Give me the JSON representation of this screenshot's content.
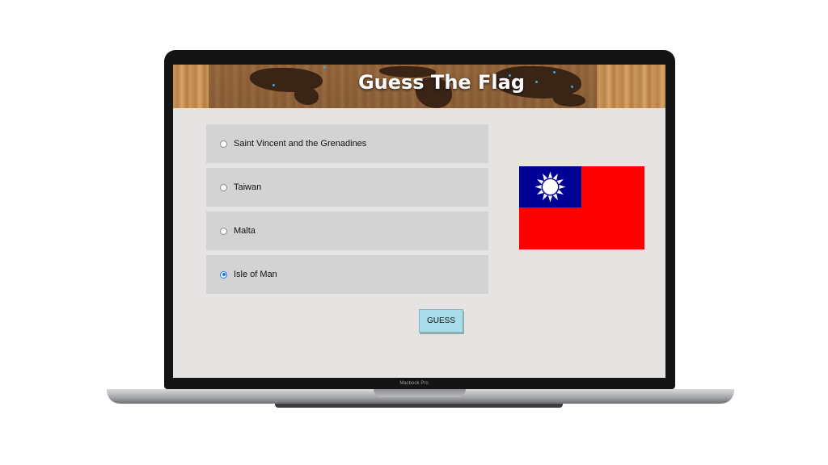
{
  "device": {
    "label": "Macbook Pro"
  },
  "app": {
    "title": "Guess The Flag"
  },
  "options": [
    {
      "label": "Saint Vincent and the Grenadines",
      "selected": false
    },
    {
      "label": "Taiwan",
      "selected": false
    },
    {
      "label": "Malta",
      "selected": false
    },
    {
      "label": "Isle of Man",
      "selected": true
    }
  ],
  "guess_button": {
    "label": "GUESS"
  },
  "flag": {
    "depicts": "Taiwan",
    "field_color": "#fe0000",
    "canton_color": "#000095",
    "sun_color": "#ffffff"
  },
  "colors": {
    "background": "#e5e4e3",
    "option_bg": "#d3d3d3",
    "button_bg": "#a9dce9",
    "selected_radio": "#1a73e8"
  }
}
